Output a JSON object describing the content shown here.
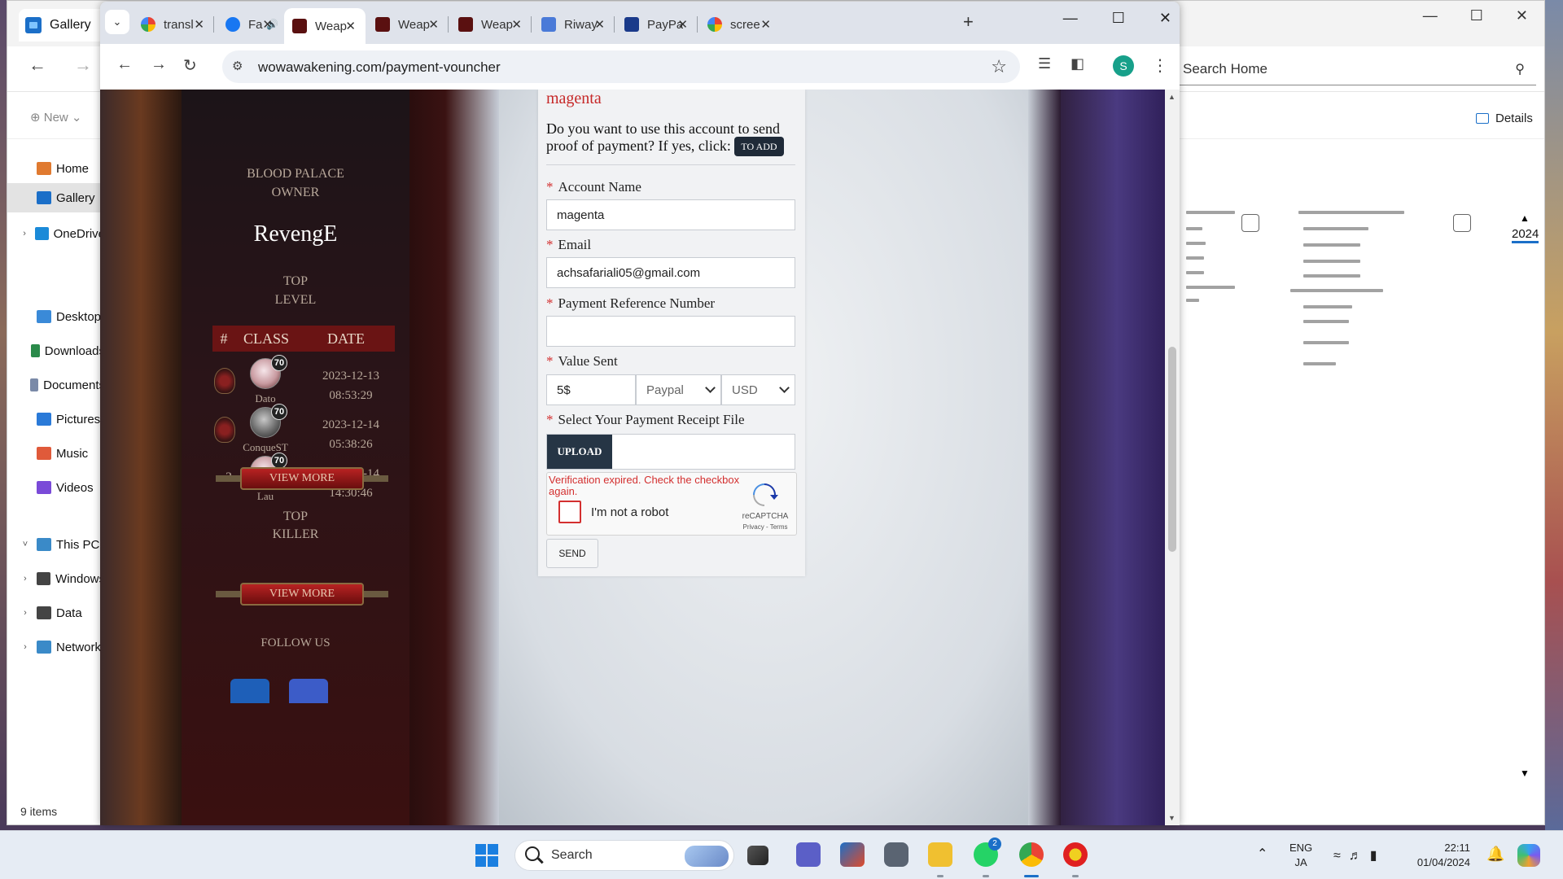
{
  "explorer": {
    "tab_title": "Gallery",
    "search_placeholder": "Search Home",
    "new_label": "New",
    "details_label": "Details",
    "status": "9 items",
    "year_label": "2024",
    "nav": [
      {
        "label": "Home",
        "icon": "home-icon"
      },
      {
        "label": "Gallery",
        "icon": "gallery-icon",
        "selected": true
      },
      {
        "label": "OneDrive",
        "icon": "onedrive-icon"
      },
      {
        "label": "Desktop",
        "icon": "desktop-icon"
      },
      {
        "label": "Downloads",
        "icon": "download-icon"
      },
      {
        "label": "Documents",
        "icon": "documents-icon"
      },
      {
        "label": "Pictures",
        "icon": "pictures-icon"
      },
      {
        "label": "Music",
        "icon": "music-icon"
      },
      {
        "label": "Videos",
        "icon": "videos-icon"
      },
      {
        "label": "This PC",
        "icon": "pc-icon"
      },
      {
        "label": "Windows",
        "icon": "drive-icon"
      },
      {
        "label": "Data",
        "icon": "drive-icon"
      },
      {
        "label": "Network",
        "icon": "network-icon"
      }
    ]
  },
  "chrome": {
    "tabs": [
      {
        "title": "transl",
        "icon": "google-icon"
      },
      {
        "title": "Fa",
        "icon": "facebook-icon",
        "audio": true
      },
      {
        "title": "Weap",
        "icon": "wow-icon",
        "active": true
      },
      {
        "title": "Weap",
        "icon": "wow-icon"
      },
      {
        "title": "Weap",
        "icon": "wow-icon"
      },
      {
        "title": "Riway",
        "icon": "riwayat-icon"
      },
      {
        "title": "PayPa",
        "icon": "paypal-icon"
      },
      {
        "title": "scree",
        "icon": "google-icon"
      }
    ],
    "url": "wowawakening.com/payment-vouncher",
    "profile_initial": "S"
  },
  "sidebar": {
    "owner_title_line1": "BLOOD PALACE",
    "owner_title_line2": "OWNER",
    "owner_name": "RevengE",
    "top_level_line1": "TOP",
    "top_level_line2": "LEVEL",
    "table_headers": {
      "rank": "#",
      "class": "CLASS",
      "date": "DATE"
    },
    "rows": [
      {
        "rank": "",
        "level": "70",
        "name": "Dato",
        "date": "2023-12-13",
        "time": "08:53:29"
      },
      {
        "rank": "",
        "level": "70",
        "name": "ConqueST",
        "date": "2023-12-14",
        "time": "05:38:26"
      },
      {
        "rank": "3",
        "level": "70",
        "name": "Lau",
        "date": "2023-12-14",
        "time": "14:30:46"
      }
    ],
    "view_more": "VIEW MORE",
    "top_killer_line1": "TOP",
    "top_killer_line2": "KILLER",
    "follow_us": "FOLLOW US"
  },
  "form": {
    "account_top": "magenta",
    "use_account_text": "Do you want to use this account to send proof of payment? If yes, click:",
    "to_add_button": "TO ADD",
    "account_name_label": "Account Name",
    "account_name_value": "magenta",
    "email_label": "Email",
    "email_value": "achsafariali05@gmail.com",
    "payment_ref_label": "Payment Reference Number",
    "payment_ref_value": "",
    "value_sent_label": "Value Sent",
    "value_sent_amount": "5$",
    "payment_method": "Paypal",
    "currency": "USD",
    "receipt_label": "Select Your Payment Receipt File",
    "upload_button": "UPLOAD",
    "recaptcha_error": "Verification expired. Check the checkbox again.",
    "recaptcha_label": "I'm not a robot",
    "recaptcha_brand": "reCAPTCHA",
    "recaptcha_terms": "Privacy - Terms",
    "send_button": "SEND"
  },
  "taskbar": {
    "search_placeholder": "Search",
    "whatsapp_badge": "2",
    "lang_line1": "ENG",
    "lang_line2": "JA",
    "time": "22:11",
    "date": "01/04/2024"
  },
  "colors": {
    "accent_red": "#c62828",
    "dark_panel": "#263545",
    "chrome_frame": "#dfe3eb"
  }
}
